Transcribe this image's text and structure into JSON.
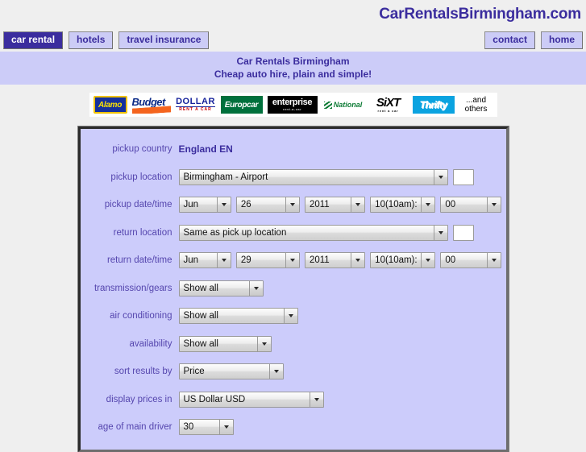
{
  "header": {
    "site_title": "CarRentalsBirmingham.com"
  },
  "nav": {
    "left_tabs": [
      {
        "label": "car rental",
        "active": true
      },
      {
        "label": "hotels",
        "active": false
      },
      {
        "label": "travel insurance",
        "active": false
      }
    ],
    "right_tabs": [
      {
        "label": "contact"
      },
      {
        "label": "home"
      }
    ]
  },
  "tagline": {
    "line1": "Car Rentals Birmingham",
    "line2": "Cheap auto hire, plain and simple!"
  },
  "brands": [
    {
      "name": "Alamo"
    },
    {
      "name": "Budget"
    },
    {
      "name": "DOLLAR",
      "sub": "RENT A CAR"
    },
    {
      "name": "Europcar"
    },
    {
      "name": "enterprise",
      "sub": "rent-a-car"
    },
    {
      "name": "National"
    },
    {
      "name": "SiXT",
      "sub": "rent a car"
    },
    {
      "name": "Thrifty"
    },
    {
      "name_line1": "...and",
      "name_line2": "others"
    }
  ],
  "form": {
    "pickup_country": {
      "label": "pickup country",
      "value": "England EN"
    },
    "pickup_location": {
      "label": "pickup location",
      "value": "Birmingham - Airport",
      "extra_input_value": ""
    },
    "pickup_datetime": {
      "label": "pickup date/time",
      "month": "Jun",
      "day": "26",
      "year": "2011",
      "hour": "10(10am):",
      "minute": "00"
    },
    "return_location": {
      "label": "return location",
      "value": "Same as pick up location",
      "extra_input_value": ""
    },
    "return_datetime": {
      "label": "return date/time",
      "month": "Jun",
      "day": "29",
      "year": "2011",
      "hour": "10(10am):",
      "minute": "00"
    },
    "transmission": {
      "label": "transmission/gears",
      "value": "Show all"
    },
    "air_conditioning": {
      "label": "air conditioning",
      "value": "Show all"
    },
    "availability": {
      "label": "availability",
      "value": "Show all"
    },
    "sort_results": {
      "label": "sort results by",
      "value": "Price"
    },
    "display_prices": {
      "label": "display prices in",
      "value": "US Dollar USD"
    },
    "driver_age": {
      "label": "age of main driver",
      "value": "30"
    }
  },
  "colors": {
    "brand_purple": "#3b2d9e",
    "label_purple": "#5546ae",
    "panel_lavender": "#ccccfb",
    "band_lavender": "#ccccf8",
    "page_background": "#efefef"
  }
}
